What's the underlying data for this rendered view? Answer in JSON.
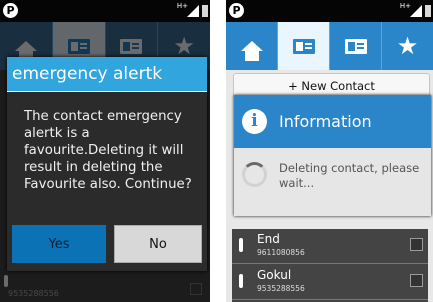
{
  "left_screen": {
    "status_app_icon": "P",
    "status_network": "H+",
    "tabs": [
      "home-icon",
      "contacts-card-icon",
      "contacts-card-icon",
      "star-icon"
    ],
    "alert": {
      "title": "emergency alertk",
      "message": "The contact emergency alertk is a favourite.Deleting it will result in deleting the Favourite also. Continue?",
      "yes_label": "Yes",
      "no_label": "No"
    },
    "background_phone": "9535288556"
  },
  "right_screen": {
    "status_app_icon": "P",
    "status_network": "H+",
    "tabs": [
      "home-icon",
      "contacts-card-icon",
      "contacts-card-icon",
      "star-icon"
    ],
    "new_contact_label": "+ New Contact",
    "info": {
      "title": "Information",
      "icon": "i",
      "message": "Deleting contact, please wait..."
    },
    "contacts": [
      {
        "name": "End",
        "phone": "9611080856"
      },
      {
        "name": "Gokul",
        "phone": "9535288556"
      }
    ]
  },
  "colors": {
    "accent": "#31a6de",
    "tab_blue": "#2b85c9",
    "yes_button": "#0b73b5"
  }
}
